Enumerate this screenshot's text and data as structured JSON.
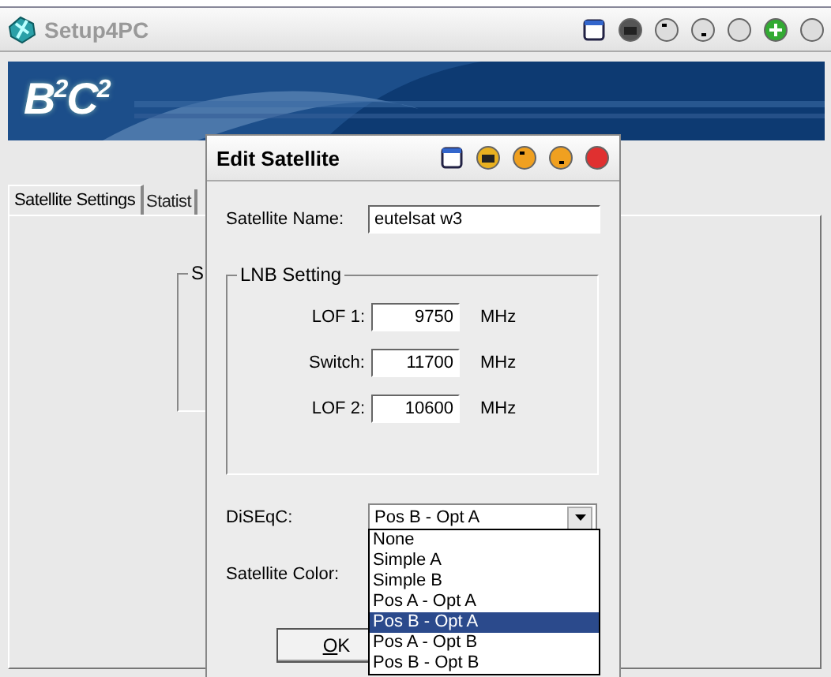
{
  "window": {
    "title": "Setup4PC"
  },
  "banner": {
    "logo": "B$^{2}$C$^{2}$"
  },
  "tabs": [
    {
      "label": "Satellite Settings",
      "selected": true
    },
    {
      "label": "Statist",
      "selected": false
    }
  ],
  "panel": {
    "group_label": "S"
  },
  "dialog": {
    "title": "Edit Satellite",
    "name_label": "Satellite Name:",
    "name_value": "eutelsat w3",
    "lnb": {
      "title": "LNB Setting",
      "rows": [
        {
          "label": "LOF 1:",
          "value": "9750",
          "unit": "MHz"
        },
        {
          "label": "Switch:",
          "value": "11700",
          "unit": "MHz"
        },
        {
          "label": "LOF 2:",
          "value": "10600",
          "unit": "MHz"
        }
      ]
    },
    "diseqc": {
      "label": "DiSEqC:",
      "value": "Pos B - Opt A",
      "expanded": true,
      "options": [
        {
          "label": "None",
          "selected": false
        },
        {
          "label": "Simple A",
          "selected": false
        },
        {
          "label": "Simple B",
          "selected": false
        },
        {
          "label": "Pos A - Opt A",
          "selected": false
        },
        {
          "label": "Pos B - Opt A",
          "selected": true
        },
        {
          "label": "Pos A - Opt B",
          "selected": false
        },
        {
          "label": "Pos B - Opt B",
          "selected": false
        }
      ]
    },
    "color_label": "Satellite Color:",
    "ok_button": "OK"
  }
}
